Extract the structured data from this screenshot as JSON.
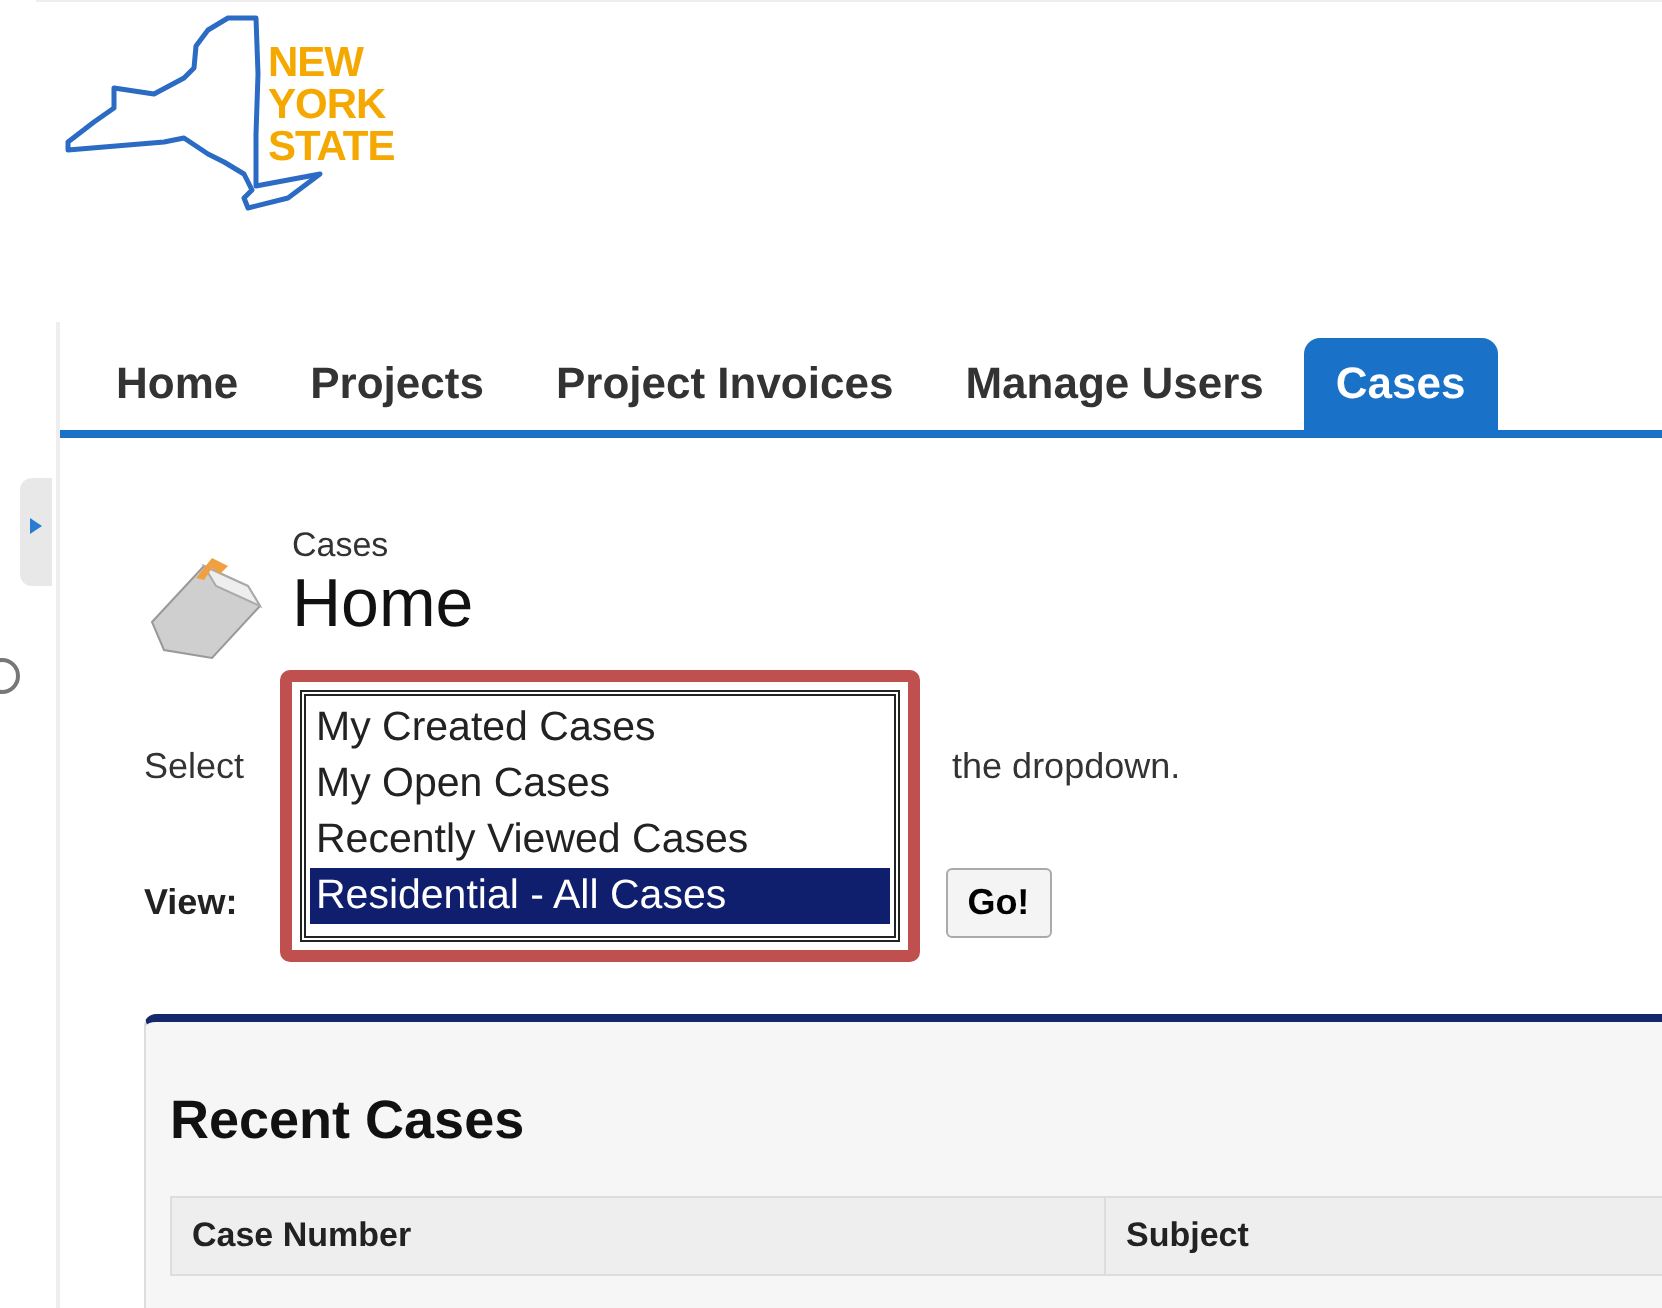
{
  "logo": {
    "lines": [
      "NEW",
      "YORK",
      "STATE"
    ]
  },
  "tabs": [
    {
      "label": "Home",
      "selected": false
    },
    {
      "label": "Projects",
      "selected": false
    },
    {
      "label": "Project Invoices",
      "selected": false
    },
    {
      "label": "Manage Users",
      "selected": false
    },
    {
      "label": "Cases",
      "selected": true
    }
  ],
  "page_header": {
    "section": "Cases",
    "title": "Home"
  },
  "instruction_parts": [
    "Select",
    "the dropdown."
  ],
  "view": {
    "label": "View:",
    "options": [
      {
        "label": "My Created Cases",
        "selected": false
      },
      {
        "label": "My Open Cases",
        "selected": false
      },
      {
        "label": "Recently Viewed Cases",
        "selected": false
      },
      {
        "label": "Residential - All Cases",
        "selected": true
      }
    ],
    "button": "Go!"
  },
  "recent_cases": {
    "title": "Recent Cases",
    "columns": [
      "Case Number",
      "Subject"
    ]
  }
}
